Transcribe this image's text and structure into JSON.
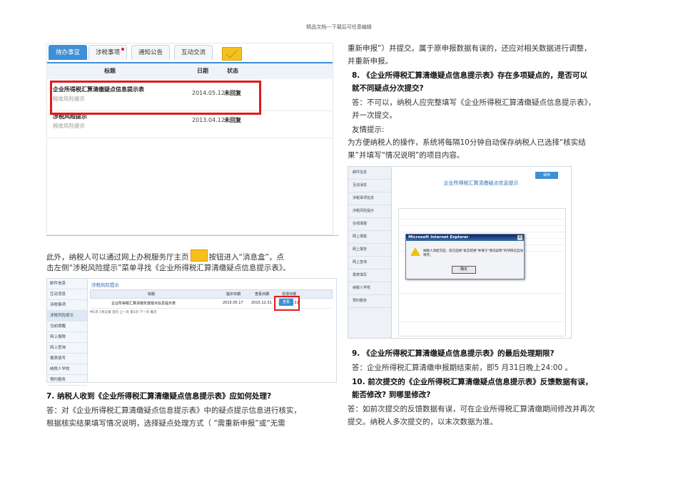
{
  "header": "精品文档---下载后可任意编辑",
  "screenshot1": {
    "tabs": [
      "待办事宜",
      "涉税事项",
      "通知公告",
      "互动交流"
    ],
    "columns": [
      "标题",
      "日期",
      "状态"
    ],
    "rows": [
      {
        "title": "企业所得税汇算清缴疑点信息提示表",
        "sub": "税收风险提示",
        "date": "2014.05.12",
        "status": "未回复"
      },
      {
        "title": "涉税风险提示",
        "sub": "税收风险提示",
        "date": "2013.04.12",
        "status": "未回复"
      }
    ]
  },
  "left": {
    "p1a": "此外，纳税人可以通过网上办税服务厅主页",
    "p1b": "按钮进入“消息盒”，点",
    "p2": "击左侧“涉税风险提示”菜单寻找《企业所得税汇算清缴疑点信息提示表》。",
    "q7": "7.   纳税人收到《企业所得税汇算清缴疑点信息提示表》应如何处理?",
    "a7a": "答：对《企业所得税汇算清缴疑点信息提示表》中的疑点提示信息进行核实，",
    "a7b": "根据核实结果填写情况说明，选择疑点处理方式（ “需重新申报”或“无需"
  },
  "screenshot2": {
    "menu": [
      "邮件信息",
      "互动消息",
      "涉税事项",
      "涉税风险提示",
      "当前提醒",
      "网上报税",
      "网上查询",
      "报表填写",
      "纳税人学校",
      "预约服务"
    ],
    "title": "涉税风险提示",
    "columns": [
      "标题",
      "提示日期",
      "查看日期",
      "反馈日期"
    ],
    "row": {
      "title": "企业所得税汇算清缴年度疑点信息提示表",
      "d1": "2015.05.17",
      "d2": "2015.12.31",
      "d3": "2015.12.31",
      "btn": "查看"
    },
    "pager": "共1页 1条记录   首页  上一页  第1页  下一页  尾页"
  },
  "right": {
    "r1": "重新申报”）并提交。属于原申报数据有误的，还应对相关数据进行调整，",
    "r2": "并重新申报。",
    "q8a": "8.   《企业所得税汇算清缴疑点信息提示表》存在多项疑点的，是否可以",
    "q8b": "就不同疑点分次提交?",
    "a8a": "答：不可以，纳税人应完整填写《企业所得税汇算清缴疑点信息提示表》，",
    "a8b": "并一次提交。",
    "tip": "友情提示:",
    "tip1": "为方便纳税人的操作，系统将每隔10分钟自动保存纳税人已选择“核实结",
    "tip2": "果”并填写“情况说明”的项目内容。",
    "q9": "9.   《企业所得税汇算清缴疑点信息提示表》的最后处理期限?",
    "a9": "答：企业所得税汇算清缴申报期结束前，即5 月31日晚上24:00 。",
    "q10a": "10.  前次提交的《企业所得税汇算清缴疑点信息提示表》反馈数据有误，",
    "q10b": "能否修改? 到哪里修改?",
    "a10a": "答：如前次提交的反馈数据有误，可在企业所得税汇算清缴期间修改并再次",
    "a10b": "提交。纳税人多次提交的，以末次数据为准。"
  },
  "screenshot3": {
    "menu": [
      "邮件信息",
      "互动消息",
      "涉税事项信息",
      "涉税风险提示",
      "在线填报",
      "网上报税",
      "网上报告",
      "网上查询",
      "报表填写",
      "纳税人学校",
      "预约服务"
    ],
    "title": "企业所得税汇算清缴疑点信息提示",
    "button": "保存",
    "dialog_title": "Microsoft Internet Explorer",
    "dialog_msg": "纳税人须提交后，您已选择“核实结果”并填写“情况说明”的项目已自动保存。",
    "dialog_ok": "确定"
  }
}
